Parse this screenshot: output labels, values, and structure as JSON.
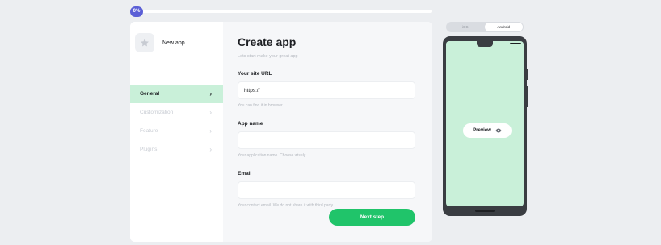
{
  "progress": {
    "label": "0%",
    "value": 0
  },
  "app": {
    "name": "New app"
  },
  "sidebar": {
    "items": [
      {
        "label": "General",
        "active": true
      },
      {
        "label": "Customization",
        "active": false
      },
      {
        "label": "Feature",
        "active": false
      },
      {
        "label": "Plugins",
        "active": false
      }
    ]
  },
  "main": {
    "title": "Create app",
    "subtitle": "Lets start make your great app",
    "fields": [
      {
        "label": "Your site URL",
        "value": "https://",
        "hint": "You can find it in browser"
      },
      {
        "label": "App name",
        "value": "",
        "hint": "Your application name. Choose wisely"
      },
      {
        "label": "Email",
        "value": "",
        "hint": "Your contact email. We do not share it with third party"
      }
    ],
    "next_label": "Next step"
  },
  "device_toggle": {
    "options": [
      "iOS",
      "Android"
    ],
    "selected": "Android"
  },
  "phone": {
    "preview_label": "Preview"
  },
  "colors": {
    "accent": "#20c46a",
    "accent_light": "#c9f0d9",
    "badge": "#5b5fd6"
  }
}
